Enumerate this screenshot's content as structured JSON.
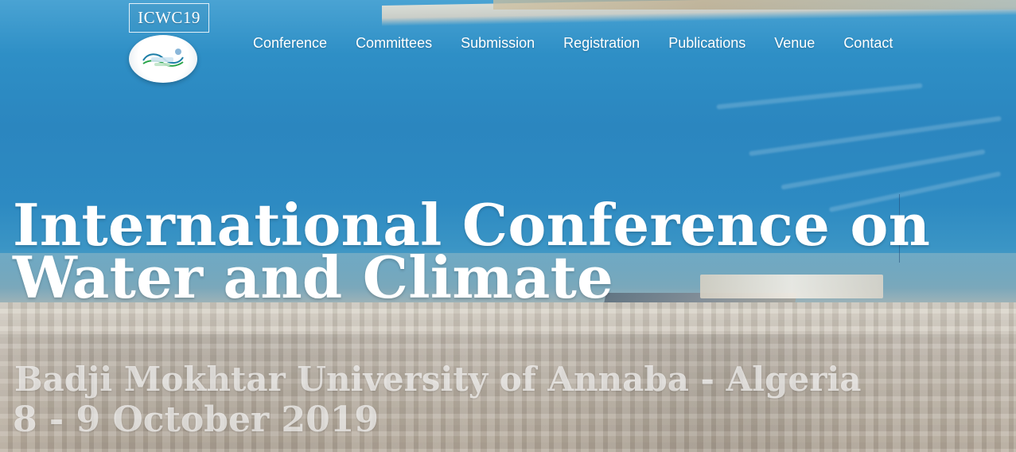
{
  "brand": {
    "box_text": "ICWC19"
  },
  "nav": {
    "items": [
      {
        "label": "Conference"
      },
      {
        "label": "Committees"
      },
      {
        "label": "Submission"
      },
      {
        "label": "Registration"
      },
      {
        "label": "Publications"
      },
      {
        "label": "Venue"
      },
      {
        "label": "Contact"
      }
    ]
  },
  "hero": {
    "title_line1": "International Conference on",
    "title_line2": "Water and Climate",
    "subtitle": "Badji Mokhtar University of Annaba - Algeria",
    "date": "8 - 9 October 2019"
  },
  "colors": {
    "text_on_image": "#ffffff"
  }
}
